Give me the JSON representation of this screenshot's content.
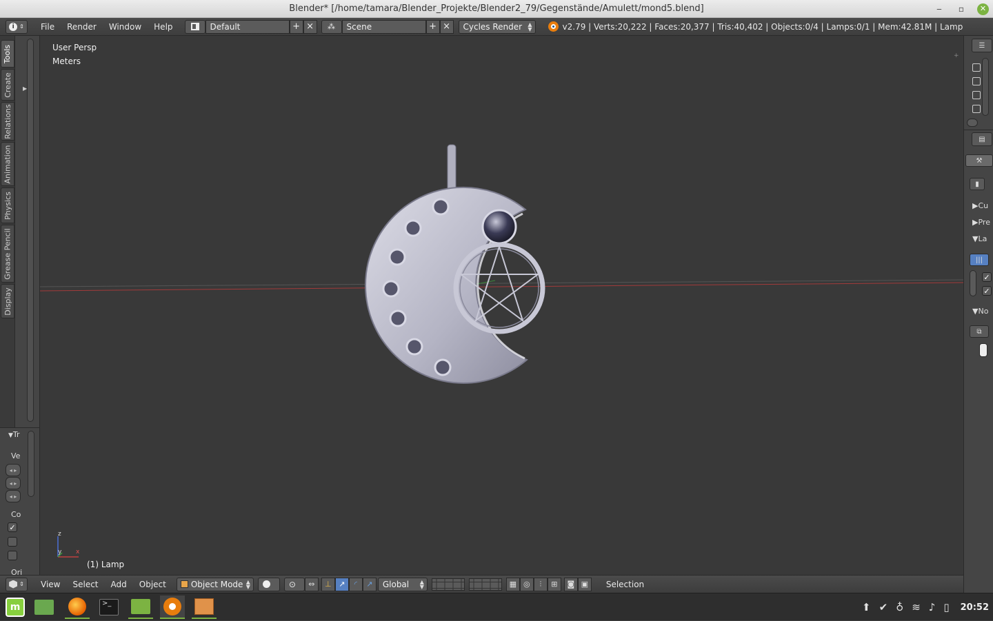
{
  "window": {
    "title": "Blender* [/home/tamara/Blender_Projekte/Blender2_79/Gegenstände/Amulett/mond5.blend]",
    "minimize_glyph": "‒",
    "maximize_glyph": "▫",
    "close_glyph": "✕"
  },
  "info_header": {
    "editor_type_icon": "info-icon",
    "menus": [
      "File",
      "Render",
      "Window",
      "Help"
    ],
    "screen_layout": "Default",
    "scene": "Scene",
    "render_engine": "Cycles Render",
    "stats": "v2.79 | Verts:20,222 | Faces:20,377 | Tris:40,402 | Objects:0/4 | Lamps:0/1 | Mem:42.81M | Lamp"
  },
  "tool_shelf": {
    "tabs": [
      "Tools",
      "Create",
      "Relations",
      "Animation",
      "Physics",
      "Grease Pencil",
      "Display"
    ],
    "active_tab": "Tools"
  },
  "operator_panel": {
    "header": "Tr",
    "vector_label": "Ve",
    "constraint_label": "Co",
    "orient_label": "Ori"
  },
  "viewport": {
    "view_name": "User Persp",
    "units": "Meters",
    "active_object": "(1) Lamp",
    "axis_z": "z",
    "axis_y": "y",
    "axis_x": "x"
  },
  "properties_panel": {
    "sections": [
      "Cu",
      "Pre",
      "La",
      "No"
    ]
  },
  "viewport_header": {
    "menus": [
      "View",
      "Select",
      "Add",
      "Object"
    ],
    "mode": "Object Mode",
    "orientation": "Global",
    "status": "Selection"
  },
  "taskbar": {
    "apps": [
      "menu-icon",
      "file-manager-icon",
      "firefox-icon",
      "terminal-icon",
      "folder-icon",
      "blender-icon",
      "archive-icon"
    ],
    "clock": "20:52"
  },
  "colors": {
    "viewport_bg": "#393939",
    "panel_bg": "#454545",
    "accent_blue": "#5680c2",
    "mint_green": "#7cb342",
    "x_axis": "#a33a3a",
    "y_axis": "#3a8a3a"
  }
}
